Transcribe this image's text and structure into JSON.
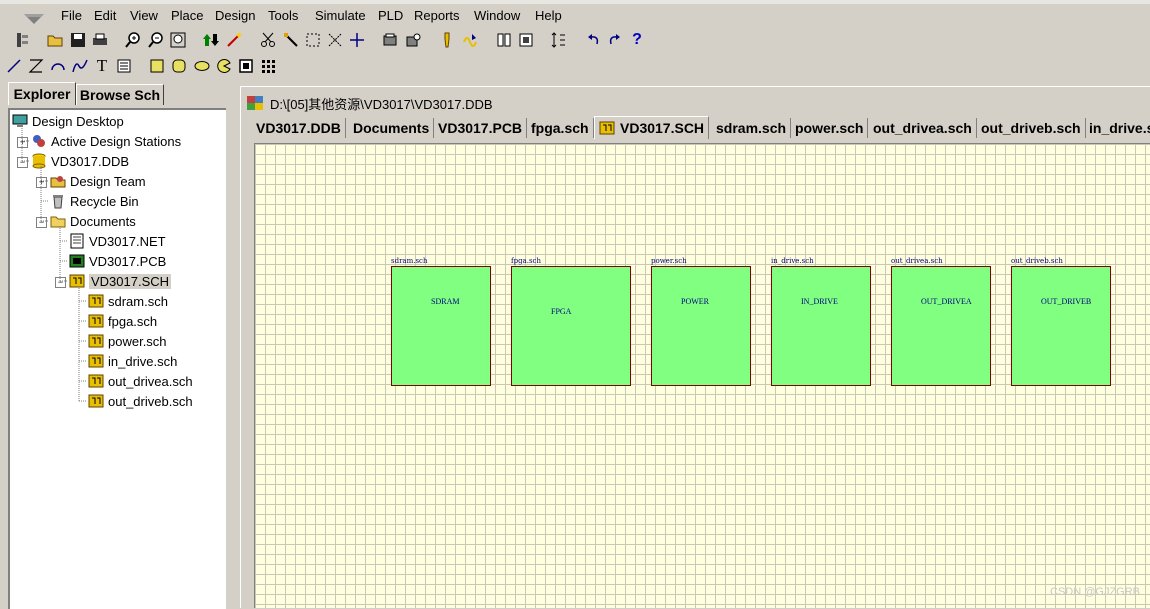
{
  "menu": [
    "File",
    "Edit",
    "View",
    "Place",
    "Design",
    "Tools",
    "Simulate",
    "PLD",
    "Reports",
    "Window",
    "Help"
  ],
  "explorer": {
    "tabs": [
      "Explorer",
      "Browse Sch"
    ],
    "tree": [
      {
        "label": "Design Desktop",
        "icon": "desktop-icon"
      },
      {
        "label": "Active Design Stations",
        "icon": "stations-icon"
      },
      {
        "label": "VD3017.DDB",
        "icon": "database-icon"
      },
      {
        "label": "Design Team",
        "icon": "team-icon"
      },
      {
        "label": "Recycle Bin",
        "icon": "recycle-bin-icon"
      },
      {
        "label": "Documents",
        "icon": "folder-icon"
      },
      {
        "label": "VD3017.NET",
        "icon": "netlist-icon"
      },
      {
        "label": "VD3017.PCB",
        "icon": "pcb-icon"
      },
      {
        "label": "VD3017.SCH",
        "icon": "schematic-icon"
      },
      {
        "label": "sdram.sch",
        "icon": "schematic-icon"
      },
      {
        "label": "fpga.sch",
        "icon": "schematic-icon"
      },
      {
        "label": "power.sch",
        "icon": "schematic-icon"
      },
      {
        "label": "in_drive.sch",
        "icon": "schematic-icon"
      },
      {
        "label": "out_drivea.sch",
        "icon": "schematic-icon"
      },
      {
        "label": "out_driveb.sch",
        "icon": "schematic-icon"
      }
    ]
  },
  "document": {
    "title": "D:\\[05]其他资源\\VD3017\\VD3017.DDB",
    "tabs": [
      "VD3017.DDB",
      "Documents",
      "VD3017.PCB",
      "fpga.sch",
      "VD3017.SCH",
      "sdram.sch",
      "power.sch",
      "out_drivea.sch",
      "out_driveb.sch",
      "in_drive.sch"
    ],
    "active_tab": "VD3017.SCH"
  },
  "sheets": [
    {
      "file": "sdram.sch",
      "name": "SDRAM"
    },
    {
      "file": "fpga.sch",
      "name": "FPGA"
    },
    {
      "file": "power.sch",
      "name": "POWER"
    },
    {
      "file": "in_drive.sch",
      "name": "IN_DRIVE"
    },
    {
      "file": "out_drivea.sch",
      "name": "OUT_DRIVEA"
    },
    {
      "file": "out_driveb.sch",
      "name": "OUT_DRIVEB"
    }
  ],
  "watermark": "CSDN @GJZGRB",
  "colors": {
    "sheet_fill": "#80ff80",
    "sheet_border": "#800000",
    "grid_background": "#ffffe0",
    "label_text": "#000080"
  }
}
